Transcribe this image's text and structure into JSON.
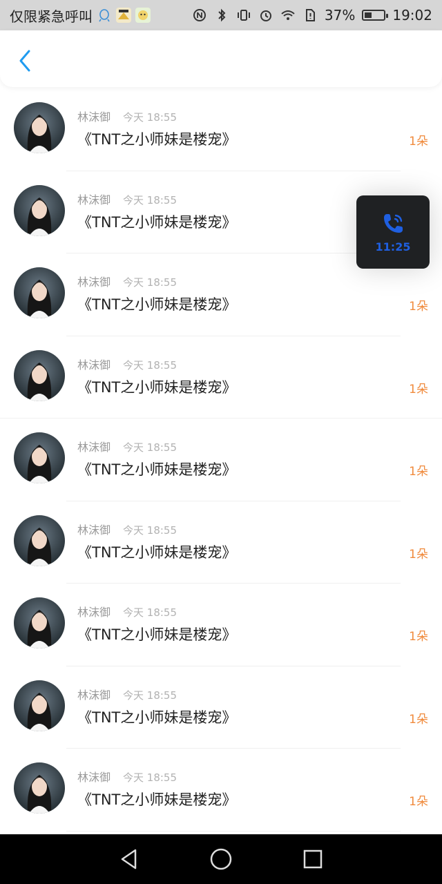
{
  "status_bar": {
    "left_text": "仅限紧急呼叫",
    "battery_percent_label": "37%",
    "battery_level": 0.37,
    "time": "19:02",
    "icons": [
      "qq-icon",
      "app-icon-nika",
      "app-icon-face",
      "nfc-icon",
      "bluetooth-icon",
      "vibrate-icon",
      "alarm-icon",
      "wifi-icon",
      "sim-alert-icon",
      "battery-icon"
    ]
  },
  "header": {
    "back_icon": "chevron-left-icon"
  },
  "list": {
    "items": [
      {
        "name": "林沫御",
        "time": "今天 18:55",
        "title": "《TNT之小师妹是楼宠》",
        "count": "1朵"
      },
      {
        "name": "林沫御",
        "time": "今天 18:55",
        "title": "《TNT之小师妹是楼宠》",
        "count": ""
      },
      {
        "name": "林沫御",
        "time": "今天 18:55",
        "title": "《TNT之小师妹是楼宠》",
        "count": "1朵"
      },
      {
        "name": "林沫御",
        "time": "今天 18:55",
        "title": "《TNT之小师妹是楼宠》",
        "count": "1朵"
      },
      {
        "name": "林沫御",
        "time": "今天 18:55",
        "title": "《TNT之小师妹是楼宠》",
        "count": "1朵"
      },
      {
        "name": "林沫御",
        "time": "今天 18:55",
        "title": "《TNT之小师妹是楼宠》",
        "count": "1朵"
      },
      {
        "name": "林沫御",
        "time": "今天 18:55",
        "title": "《TNT之小师妹是楼宠》",
        "count": "1朵"
      },
      {
        "name": "林沫御",
        "time": "今天 18:55",
        "title": "《TNT之小师妹是楼宠》",
        "count": "1朵"
      },
      {
        "name": "林沫御",
        "time": "今天 18:55",
        "title": "《TNT之小师妹是楼宠》",
        "count": "1朵"
      }
    ]
  },
  "call_overlay": {
    "icon": "phone-icon",
    "duration": "11:25"
  },
  "nav_bar": {
    "buttons": [
      "back-triangle-icon",
      "home-circle-icon",
      "recents-square-icon"
    ]
  },
  "colors": {
    "accent_blue": "#1f9bf0",
    "count_orange": "#f08a3c",
    "call_blue": "#1f5fe0"
  }
}
